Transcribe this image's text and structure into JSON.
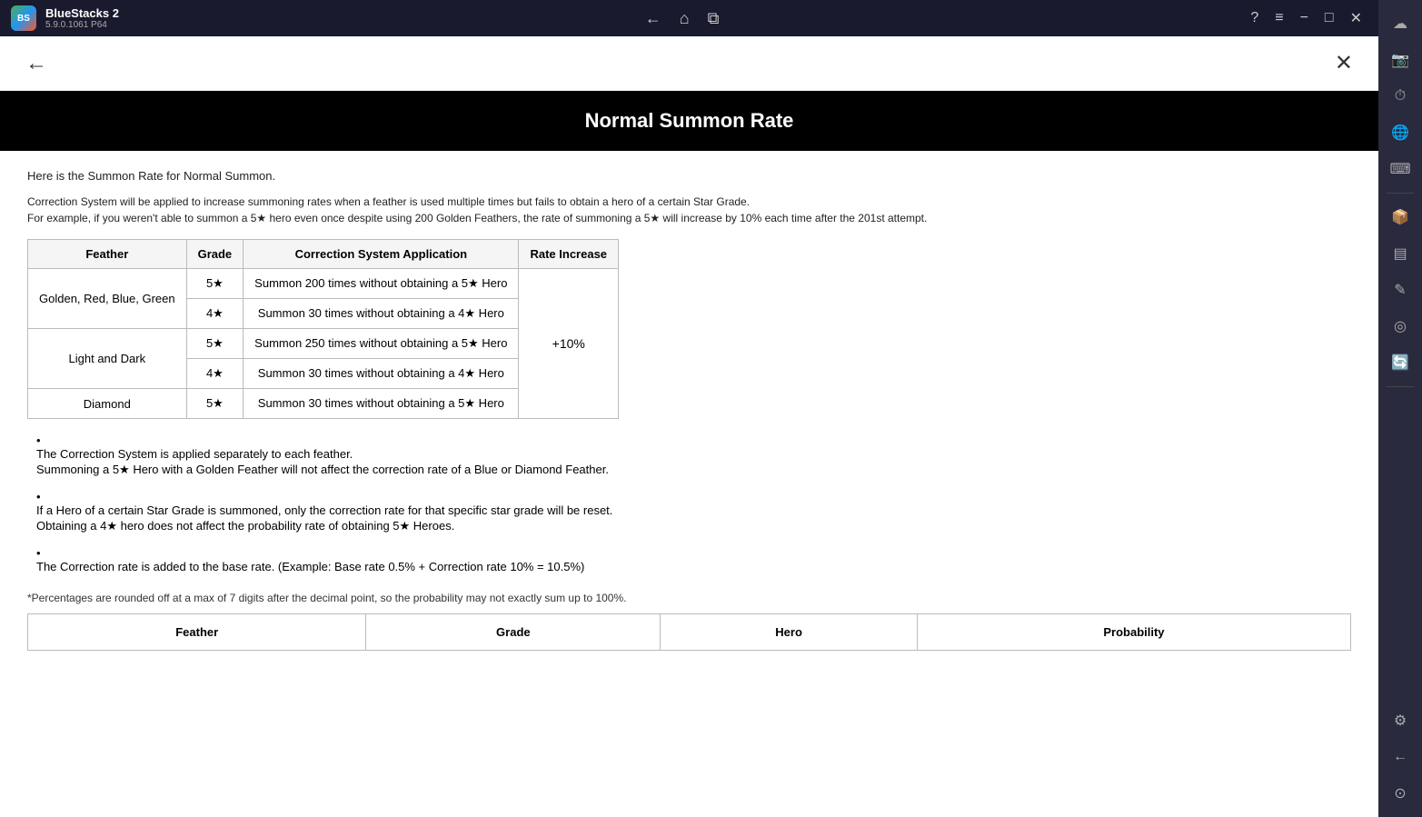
{
  "app": {
    "name": "BlueStacks 2",
    "version": "5.9.0.1061 P64",
    "icon_label": "BS"
  },
  "topbar": {
    "back_icon": "←",
    "home_icon": "⌂",
    "multi_icon": "⧉",
    "help_icon": "?",
    "menu_icon": "≡",
    "minimize_icon": "−",
    "maximize_icon": "□",
    "close_icon": "✕",
    "sidebar_close_icon": "✕"
  },
  "content_nav": {
    "back_label": "←",
    "close_label": "✕"
  },
  "title": "Normal Summon Rate",
  "intro": "Here is the Summon Rate for Normal Summon.",
  "correction_text_1": "Correction System will be applied to increase summoning rates when a feather is used multiple times but fails to obtain a hero of a certain Star Grade.",
  "correction_text_2": "For example, if you weren't able to summon a 5★ hero even once despite using 200 Golden Feathers, the rate of summoning a 5★ will increase by 10% each time after the 201st attempt.",
  "table": {
    "headers": [
      "Feather",
      "Grade",
      "Correction System Application",
      "Rate Increase"
    ],
    "rows": [
      {
        "feather": "Golden, Red, Blue, Green",
        "grade": "5★",
        "condition": "Summon 200 times without obtaining a 5★ Hero",
        "rate_increase": ""
      },
      {
        "feather": "",
        "grade": "4★",
        "condition": "Summon 30 times without obtaining a 4★ Hero",
        "rate_increase": ""
      },
      {
        "feather": "Light and Dark",
        "grade": "5★",
        "condition": "Summon 250 times without obtaining a 5★ Hero",
        "rate_increase": "+10%"
      },
      {
        "feather": "",
        "grade": "4★",
        "condition": "Summon 30 times without obtaining a 4★ Hero",
        "rate_increase": ""
      },
      {
        "feather": "Diamond",
        "grade": "5★",
        "condition": "Summon 30 times without obtaining a 5★ Hero",
        "rate_increase": ""
      }
    ],
    "rate_increase_value": "+10%"
  },
  "bullets": [
    {
      "line1": "The Correction System is applied separately to each feather.",
      "line2": "Summoning a 5★ Hero with a Golden Feather will not affect the correction rate of a Blue or Diamond Feather."
    },
    {
      "line1": "If a Hero of a certain Star Grade is summoned, only the correction rate for that specific star grade will be reset.",
      "line2": "Obtaining a 4★ hero does not affect the probability rate of obtaining 5★ Heroes."
    },
    {
      "line1": "The Correction rate is added to the base rate. (Example: Base rate 0.5% + Correction rate 10% = 10.5%)",
      "line2": ""
    }
  ],
  "disclaimer": "*Percentages are rounded off at a max of 7 digits after the decimal point, so the probability may not exactly sum up to 100%.",
  "bottom_table": {
    "headers": [
      "Feather",
      "Grade",
      "Hero",
      "Probability"
    ]
  },
  "sidebar": {
    "icons": [
      "☁",
      "📷",
      "⏱",
      "🌐",
      "⌨",
      "📦",
      "▤",
      "✎",
      "◎",
      "🔄",
      "⚙",
      "←",
      "⊙"
    ]
  }
}
